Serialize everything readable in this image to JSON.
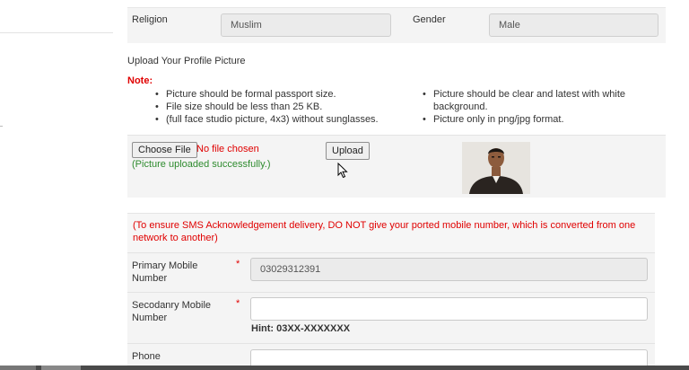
{
  "religion": {
    "label": "Religion",
    "value": "Muslim"
  },
  "gender": {
    "label": "Gender",
    "value": "Male"
  },
  "upload_section": {
    "title": "Upload Your Profile Picture",
    "note_label": "Note:",
    "notes_left": [
      "Picture should be formal passport size.",
      "File size should be less than 25 KB.",
      "(full face studio picture, 4x3) without sunglasses."
    ],
    "notes_right": [
      "Picture should be clear and latest with white background.",
      "Picture only in png/jpg format."
    ],
    "choose_file_label": "Choose File",
    "no_file_text": "No file chosen",
    "success_text": "(Picture uploaded successfully.)",
    "upload_button_label": "Upload"
  },
  "sms_notice": "(To ensure SMS Acknowledgement delivery, DO NOT give your ported mobile number, which is converted from one network to another)",
  "primary_mobile": {
    "label": "Primary Mobile Number",
    "required_mark": "*",
    "value": "03029312391"
  },
  "secondary_mobile": {
    "label": "Secodanry Mobile Number",
    "required_mark": "*",
    "value": "",
    "hint": "Hint: 03XX-XXXXXXX"
  },
  "phone": {
    "label": "Phone",
    "value": ""
  },
  "colors": {
    "error_red": "#e00000",
    "success_green": "#2e8b2e",
    "panel_bg": "#f4f4f4"
  }
}
